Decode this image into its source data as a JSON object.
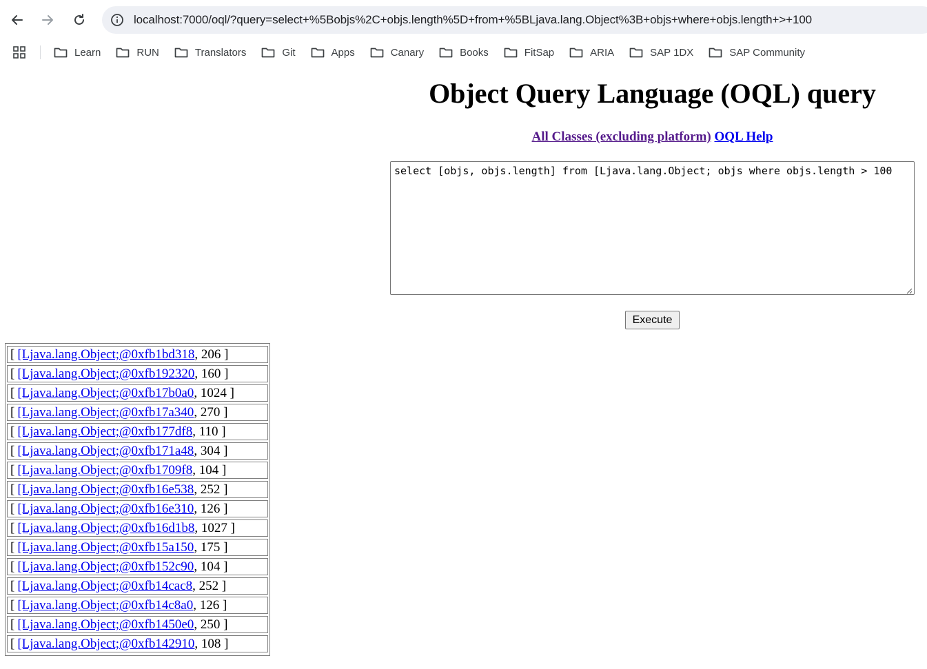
{
  "browser": {
    "url": "localhost:7000/oql/?query=select+%5Bobjs%2C+objs.length%5D+from+%5BLjava.lang.Object%3B+objs+where+objs.length+>+100",
    "bookmarks": [
      "Learn",
      "RUN",
      "Translators",
      "Git",
      "Apps",
      "Canary",
      "Books",
      "FitSap",
      "ARIA",
      "SAP 1DX",
      "SAP Community"
    ]
  },
  "page": {
    "title": "Object Query Language (OQL) query",
    "link_all_classes": "All Classes (excluding platform)",
    "link_oql_help": "OQL Help",
    "query_text": "select [objs, objs.length] from [Ljava.lang.Object; objs where objs.length > 100",
    "execute_label": "Execute"
  },
  "results": {
    "rows": [
      {
        "open": "[",
        "link": "[Ljava.lang.Object;@0xfb1bd318",
        "rest": ", 206 ]"
      },
      {
        "open": "[",
        "link": "[Ljava.lang.Object;@0xfb192320",
        "rest": ", 160 ]"
      },
      {
        "open": "[",
        "link": "[Ljava.lang.Object;@0xfb17b0a0",
        "rest": ", 1024 ]"
      },
      {
        "open": "[",
        "link": "[Ljava.lang.Object;@0xfb17a340",
        "rest": ", 270 ]"
      },
      {
        "open": "[",
        "link": "[Ljava.lang.Object;@0xfb177df8",
        "rest": ", 110 ]"
      },
      {
        "open": "[",
        "link": "[Ljava.lang.Object;@0xfb171a48",
        "rest": ", 304 ]"
      },
      {
        "open": "[",
        "link": "[Ljava.lang.Object;@0xfb1709f8",
        "rest": ", 104 ]"
      },
      {
        "open": "[",
        "link": "[Ljava.lang.Object;@0xfb16e538",
        "rest": ", 252 ]"
      },
      {
        "open": "[",
        "link": "[Ljava.lang.Object;@0xfb16e310",
        "rest": ", 126 ]"
      },
      {
        "open": "[",
        "link": "[Ljava.lang.Object;@0xfb16d1b8",
        "rest": ", 1027 ]"
      },
      {
        "open": "[",
        "link": "[Ljava.lang.Object;@0xfb15a150",
        "rest": ", 175 ]"
      },
      {
        "open": "[",
        "link": "[Ljava.lang.Object;@0xfb152c90",
        "rest": ", 104 ]"
      },
      {
        "open": "[",
        "link": "[Ljava.lang.Object;@0xfb14cac8",
        "rest": ", 252 ]"
      },
      {
        "open": "[",
        "link": "[Ljava.lang.Object;@0xfb14c8a0",
        "rest": ", 126 ]"
      },
      {
        "open": "[",
        "link": "[Ljava.lang.Object;@0xfb1450e0",
        "rest": ", 250 ]"
      },
      {
        "open": "[",
        "link": "[Ljava.lang.Object;@0xfb142910",
        "rest": ", 108 ]"
      }
    ]
  },
  "colors": {
    "link": "#0000ee",
    "visited_link": "#551a8b",
    "omnibox_bg": "#eef0f5"
  }
}
